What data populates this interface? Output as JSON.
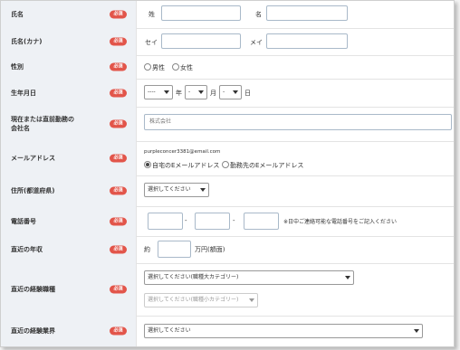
{
  "required_label": "必須",
  "name": {
    "label": "氏名",
    "sei_label": "姓",
    "mei_label": "名",
    "sei_value": "",
    "mei_value": ""
  },
  "kana": {
    "label": "氏名(カナ)",
    "sei_label": "セイ",
    "mei_label": "メイ",
    "sei_value": "",
    "mei_value": ""
  },
  "gender": {
    "label": "性別",
    "options": [
      "男性",
      "女性"
    ]
  },
  "birth": {
    "label": "生年月日",
    "year_value": "----",
    "year_unit": "年",
    "month_value": "-",
    "month_unit": "月",
    "day_value": "-",
    "day_unit": "日"
  },
  "company": {
    "label": "現在または直前勤務の\n会社名",
    "placeholder": "株式会社"
  },
  "email": {
    "label": "メールアドレス",
    "address": "purpleconcer3381@email.com",
    "options": [
      "自宅のEメールアドレス",
      "勤務先のEメールアドレス"
    ],
    "selected": 0
  },
  "address": {
    "label": "住所(都道府県)",
    "select_value": "選択してください"
  },
  "phone": {
    "label": "電話番号",
    "sep": "-",
    "note": "※日中ご連絡可能な電話番号をご記入ください"
  },
  "income": {
    "label": "直近の年収",
    "prefix": "約",
    "suffix": "万円(額面)"
  },
  "job": {
    "label": "直近の経験職種",
    "major_value": "選択してください(職種大カテゴリー)",
    "minor_value": "選択してください(職種小カテゴリー)"
  },
  "industry": {
    "label": "直近の経験業界",
    "select_value": "選択してください"
  },
  "colors": {
    "label_bg": "#eef1f5",
    "required_badge": "#e2554a",
    "input_border": "#a9b9c9"
  }
}
